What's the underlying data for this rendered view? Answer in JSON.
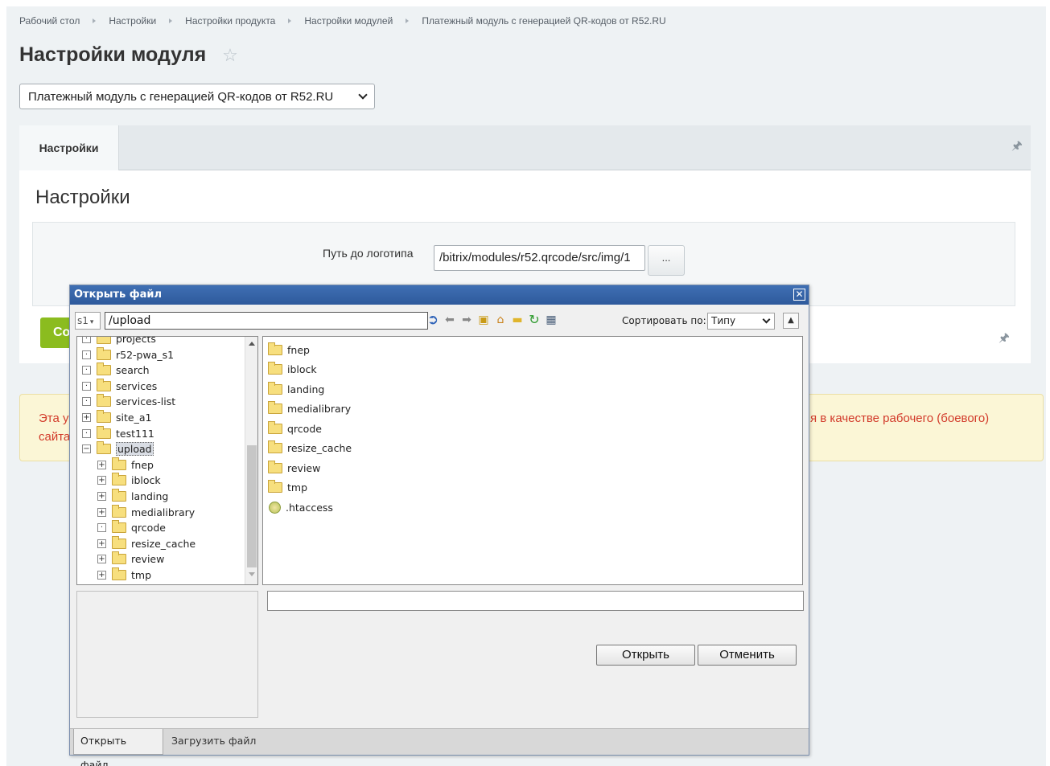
{
  "breadcrumb": [
    "Рабочий стол",
    "Настройки",
    "Настройки продукта",
    "Настройки модулей",
    "Платежный модуль с генерацией QR-кодов от R52.RU"
  ],
  "page_title": "Настройки модуля",
  "module_select": "Платежный модуль с генерацией QR-кодов от R52.RU",
  "tab_label": "Настройки",
  "panel_title": "Настройки",
  "field": {
    "label": "Путь до логотипа",
    "value": "/bitrix/modules/r52.qrcode/src/img/1",
    "browse_label": "..."
  },
  "save_button_partial": "Co",
  "warning": {
    "line1_partial": "Эта у",
    "line2_partial": "сайта",
    "right_text": "я в качестве рабочего (боевого)"
  },
  "dialog": {
    "title": "Открыть файл",
    "close_glyph": "✕",
    "site": "s1",
    "path": "/upload",
    "sort_label": "Сортировать по:",
    "sort_value": "Типу",
    "tree": [
      {
        "label": "projects",
        "level": 0,
        "toggle": "·"
      },
      {
        "label": "r52-pwa_s1",
        "level": 0,
        "toggle": "·"
      },
      {
        "label": "search",
        "level": 0,
        "toggle": "·"
      },
      {
        "label": "services",
        "level": 0,
        "toggle": "·"
      },
      {
        "label": "services-list",
        "level": 0,
        "toggle": "·"
      },
      {
        "label": "site_a1",
        "level": 0,
        "toggle": "+"
      },
      {
        "label": "test111",
        "level": 0,
        "toggle": "·"
      },
      {
        "label": "upload",
        "level": 0,
        "toggle": "−",
        "selected": true
      },
      {
        "label": "fnep",
        "level": 1,
        "toggle": "+"
      },
      {
        "label": "iblock",
        "level": 1,
        "toggle": "+"
      },
      {
        "label": "landing",
        "level": 1,
        "toggle": "+"
      },
      {
        "label": "medialibrary",
        "level": 1,
        "toggle": "+"
      },
      {
        "label": "qrcode",
        "level": 1,
        "toggle": "·"
      },
      {
        "label": "resize_cache",
        "level": 1,
        "toggle": "+"
      },
      {
        "label": "review",
        "level": 1,
        "toggle": "+"
      },
      {
        "label": "tmp",
        "level": 1,
        "toggle": "+"
      }
    ],
    "files": [
      {
        "name": "fnep",
        "type": "folder"
      },
      {
        "name": "iblock",
        "type": "folder"
      },
      {
        "name": "landing",
        "type": "folder"
      },
      {
        "name": "medialibrary",
        "type": "folder"
      },
      {
        "name": "qrcode",
        "type": "folder"
      },
      {
        "name": "resize_cache",
        "type": "folder"
      },
      {
        "name": "review",
        "type": "folder"
      },
      {
        "name": "tmp",
        "type": "folder"
      },
      {
        "name": ".htaccess",
        "type": "file"
      }
    ],
    "open_button": "Открыть",
    "cancel_button": "Отменить",
    "tab_open": "Открыть файл",
    "tab_upload": "Загрузить файл"
  },
  "colors": {
    "accent_green": "#8bbc1f",
    "dialog_title_bg": "#2e5a9c",
    "warning_text": "#d23a2a"
  }
}
